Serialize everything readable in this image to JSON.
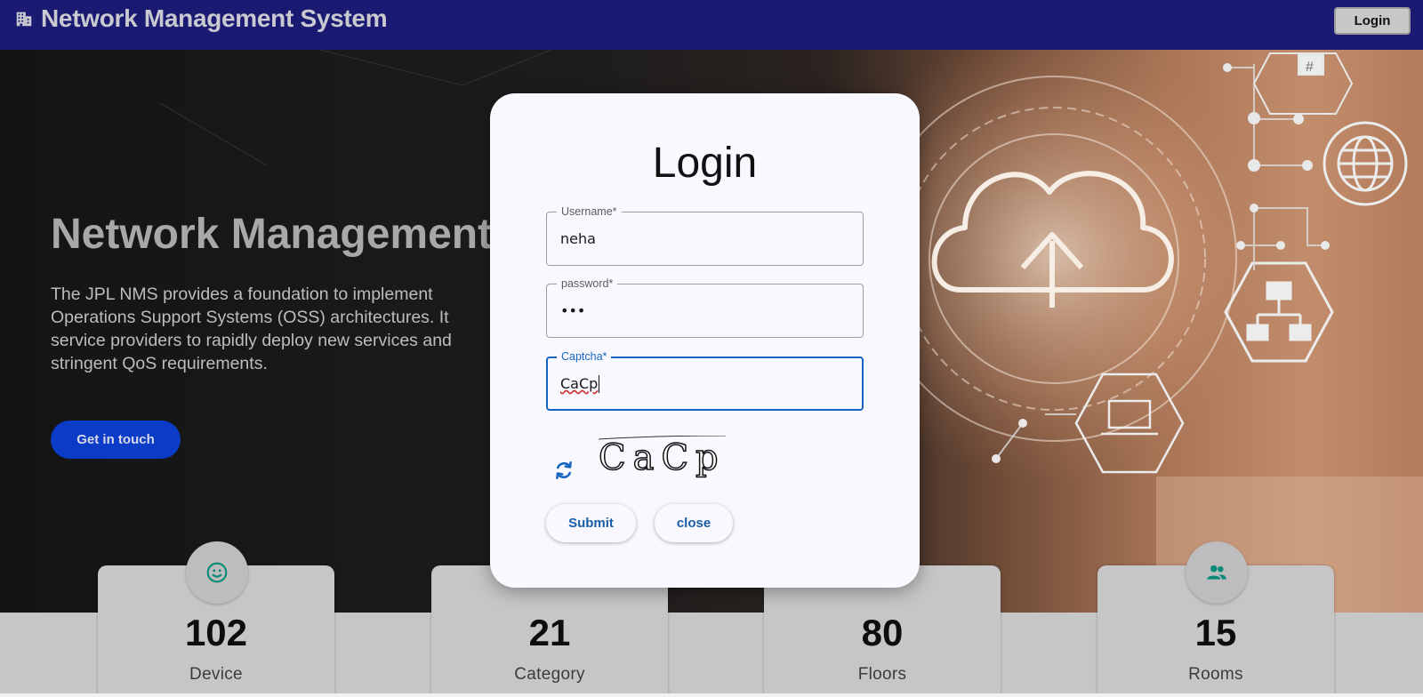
{
  "navbar": {
    "brand_icon": "office-building-icon",
    "title": "Network Management System",
    "login_label": "Login"
  },
  "hero": {
    "title": "Network Management S",
    "description": "The JPL NMS provides a foundation to implement\nOperations Support Systems (OSS) architectures. It\nservice providers to rapidly deploy new services and\nstringent QoS requirements.",
    "cta_label": "Get in touch",
    "art_icons": [
      "hash-icon",
      "cloud-upload-icon",
      "globe-icon",
      "network-hierarchy-icon",
      "laptop-icon"
    ]
  },
  "stats": [
    {
      "value": "102",
      "label": "Device",
      "icon": "smiley-icon"
    },
    {
      "value": "21",
      "label": "Category",
      "icon": ""
    },
    {
      "value": "80",
      "label": "Floors",
      "icon": ""
    },
    {
      "value": "15",
      "label": "Rooms",
      "icon": "people-icon"
    }
  ],
  "login_modal": {
    "title": "Login",
    "username": {
      "label": "Username*",
      "value": "neha"
    },
    "password": {
      "label": "password*",
      "value": "•••"
    },
    "captcha": {
      "label": "Captcha*",
      "value": "CaCp",
      "image_text": "CaCp",
      "refresh_icon": "refresh-icon"
    },
    "submit_label": "Submit",
    "close_label": "close"
  },
  "colors": {
    "navbar": "#1a1a73",
    "cta": "#0a3cc8",
    "focus": "#1565c0",
    "stat_icon": "#0a8a78",
    "modal_bg": "#f8f8fe"
  }
}
